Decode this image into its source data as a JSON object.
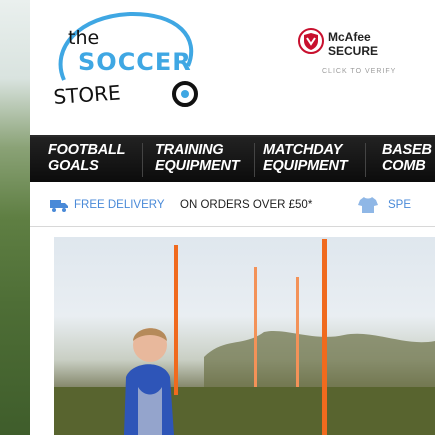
{
  "logo": {
    "line1": "the",
    "line2": "SOCCER",
    "line3": "STORE"
  },
  "badge": {
    "brand": "McAfee",
    "secure": "SECURE",
    "verify": "CLICK TO VERIFY"
  },
  "nav": [
    {
      "line1": "FOOTBALL",
      "line2": "GOALS"
    },
    {
      "line1": "TRAINING",
      "line2": "EQUIPMENT"
    },
    {
      "line1": "MATCHDAY",
      "line2": "EQUIPMENT"
    },
    {
      "line1": "BASEB",
      "line2": "COMB"
    }
  ],
  "promo": {
    "free_delivery": "FREE DELIVERY",
    "orders_over": "ON ORDERS OVER £50*",
    "special": "SPE"
  },
  "colors": {
    "nav_bg": "#111111",
    "accent_blue": "#4a8ad8",
    "logo_blue": "#3fa7e3",
    "pole_orange": "#f06a1e"
  }
}
